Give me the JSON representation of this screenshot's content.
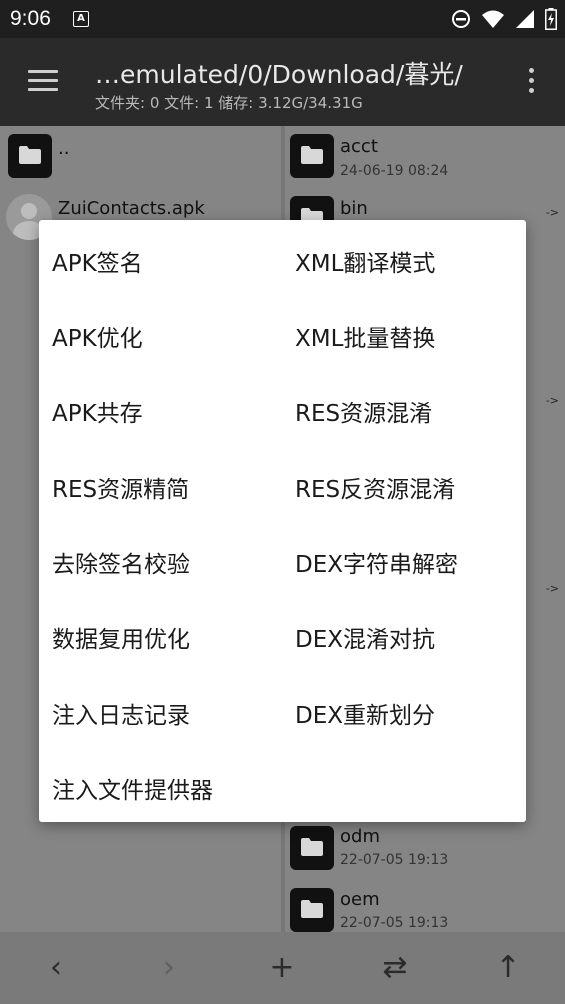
{
  "status_bar": {
    "time": "9:06",
    "notification_letter": "A"
  },
  "toolbar": {
    "title": "…emulated/0/Download/暮光/",
    "subtitle": "文件夹: 0  文件: 1  储存: 3.12G/34.31G"
  },
  "left_pane": {
    "parent_label": "..",
    "file_name": "ZuiContacts.apk"
  },
  "right_pane": {
    "entries": [
      {
        "name": "acct",
        "date": "24-06-19 08:24"
      },
      {
        "name": "bin",
        "date": ""
      },
      {
        "name": "odm",
        "date": "22-07-05 19:13"
      },
      {
        "name": "oem",
        "date": "22-07-05 19:13"
      }
    ],
    "link_arrow": "->"
  },
  "menu": {
    "left": [
      "APK签名",
      "APK优化",
      "APK共存",
      "RES资源精简",
      "去除签名校验",
      "数据复用优化",
      "注入日志记录",
      "注入文件提供器"
    ],
    "right": [
      "XML翻译模式",
      "XML批量替换",
      "RES资源混淆",
      "RES反资源混淆",
      "DEX字符串解密",
      "DEX混淆对抗",
      "DEX重新划分"
    ]
  },
  "bottom_bar": {
    "back": "‹",
    "forward": "›",
    "add": "+",
    "swap": "⇄",
    "up": "↑"
  }
}
